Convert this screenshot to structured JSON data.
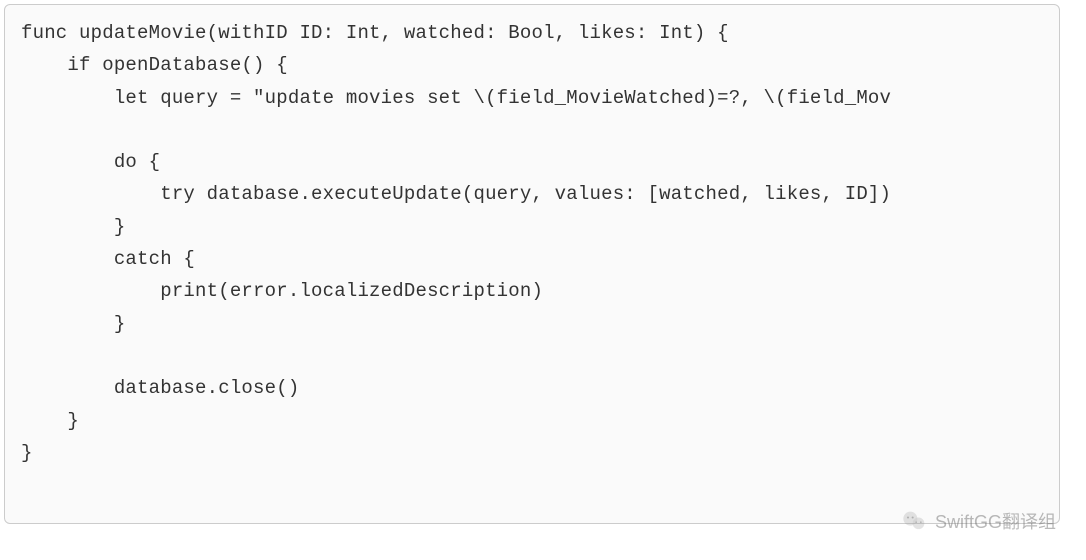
{
  "code": {
    "lines": [
      "func updateMovie(withID ID: Int, watched: Bool, likes: Int) {",
      "    if openDatabase() {",
      "        let query = \"update movies set \\(field_MovieWatched)=?, \\(field_Mov",
      "",
      "        do {",
      "            try database.executeUpdate(query, values: [watched, likes, ID])",
      "        }",
      "        catch {",
      "            print(error.localizedDescription)",
      "        }",
      "",
      "        database.close()",
      "    }",
      "}"
    ]
  },
  "watermark": {
    "text": "SwiftGG翻译组",
    "icon_name": "wechat-icon"
  }
}
